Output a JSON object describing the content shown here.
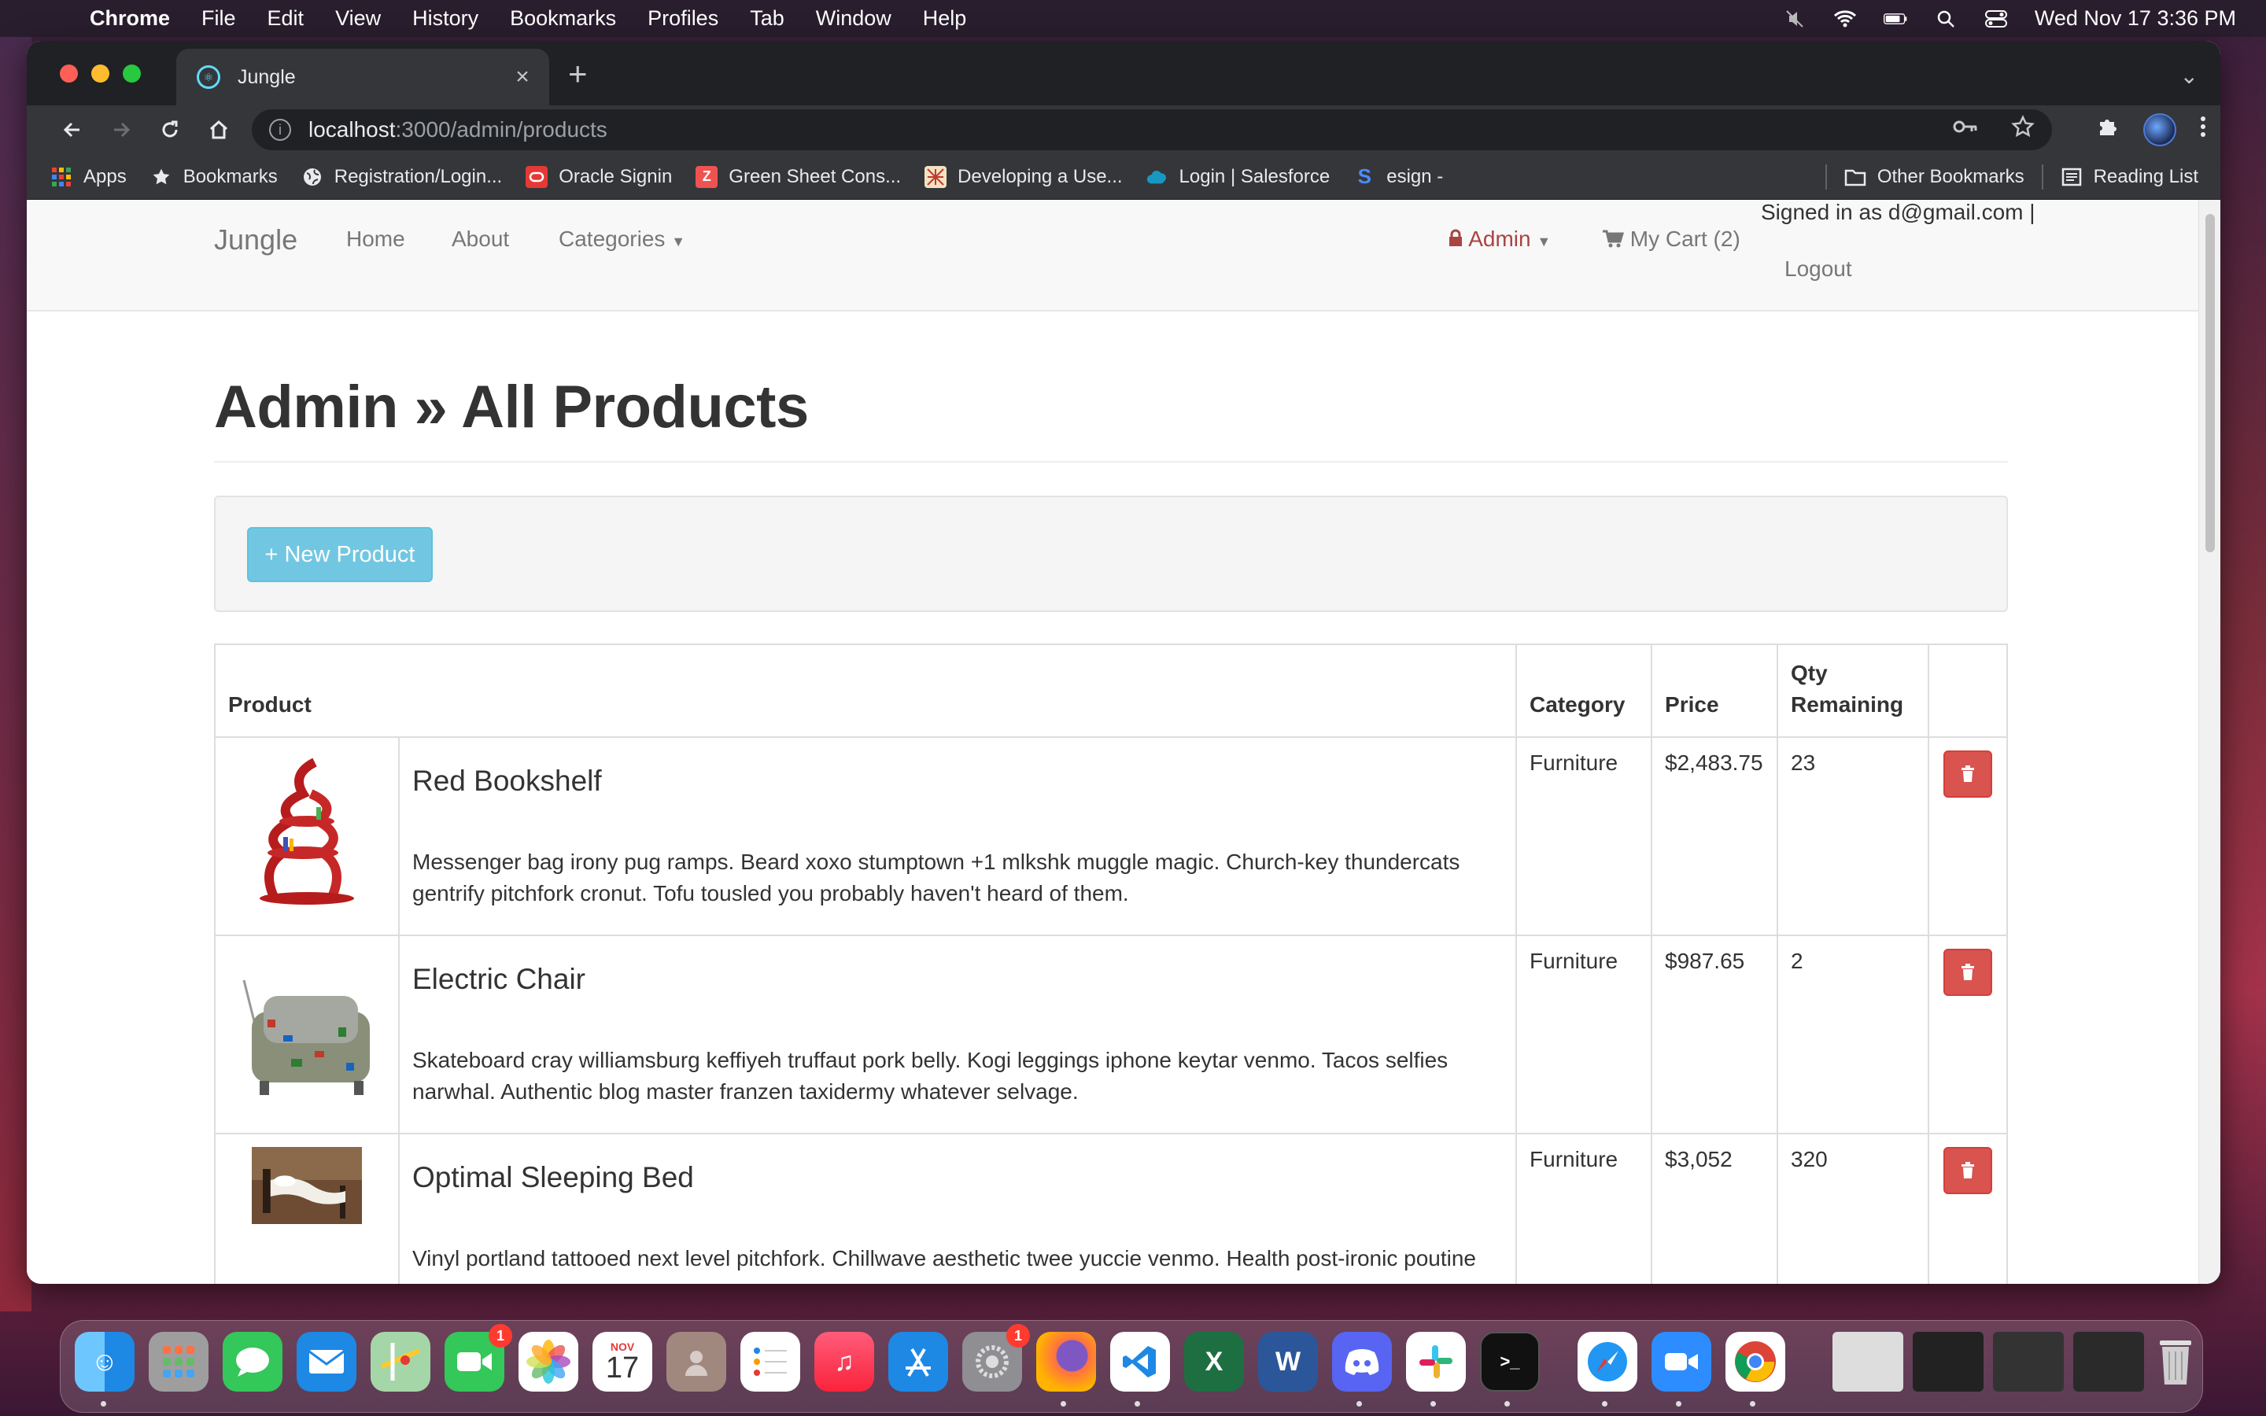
{
  "menubar": {
    "app": "Chrome",
    "items": [
      "File",
      "Edit",
      "View",
      "History",
      "Bookmarks",
      "Profiles",
      "Tab",
      "Window",
      "Help"
    ],
    "datetime": "Wed Nov 17  3:36 PM"
  },
  "browser": {
    "tab_title": "Jungle",
    "url_host": "localhost",
    "url_path": ":3000/admin/products",
    "bookmarks": [
      "Apps",
      "Bookmarks",
      "Registration/Login...",
      "Oracle Signin",
      "Green Sheet Cons...",
      "Developing a Use...",
      "Login | Salesforce",
      "esign -"
    ],
    "other_bookmarks": "Other Bookmarks",
    "reading_list": "Reading List"
  },
  "navbar": {
    "brand": "Jungle",
    "home": "Home",
    "about": "About",
    "categories": "Categories",
    "admin": "Admin",
    "cart": "My Cart (2)",
    "signed_in": "Signed in as d@gmail.com |",
    "logout": "Logout"
  },
  "page": {
    "title": "Admin » All Products",
    "new_product": "+ New Product"
  },
  "table": {
    "headers": {
      "product": "Product",
      "category": "Category",
      "price": "Price",
      "qty": "Qty Remaining"
    },
    "rows": [
      {
        "name": "Red Bookshelf",
        "description": "Messenger bag irony pug ramps. Beard xoxo stumptown +1 mlkshk muggle magic. Church-key thundercats gentrify pitchfork cronut. Tofu tousled you probably haven't heard of them.",
        "category": "Furniture",
        "price": "$2,483.75",
        "qty": "23"
      },
      {
        "name": "Electric Chair",
        "description": "Skateboard cray williamsburg keffiyeh truffaut pork belly. Kogi leggings iphone keytar venmo. Tacos selfies narwhal. Authentic blog master franzen taxidermy whatever selvage.",
        "category": "Furniture",
        "price": "$987.65",
        "qty": "2"
      },
      {
        "name": "Optimal Sleeping Bed",
        "description": "Vinyl portland tattooed next level pitchfork. Chillwave aesthetic twee yuccie venmo. Health post-ironic poutine",
        "category": "Furniture",
        "price": "$3,052",
        "qty": "320"
      }
    ]
  },
  "dock": {
    "calendar_month": "NOV",
    "calendar_day": "17",
    "facetime_badge": "1",
    "settings_badge": "1"
  },
  "colors": {
    "accent_info": "#5bc0de",
    "danger": "#d9534f",
    "admin_red": "#a94442"
  }
}
